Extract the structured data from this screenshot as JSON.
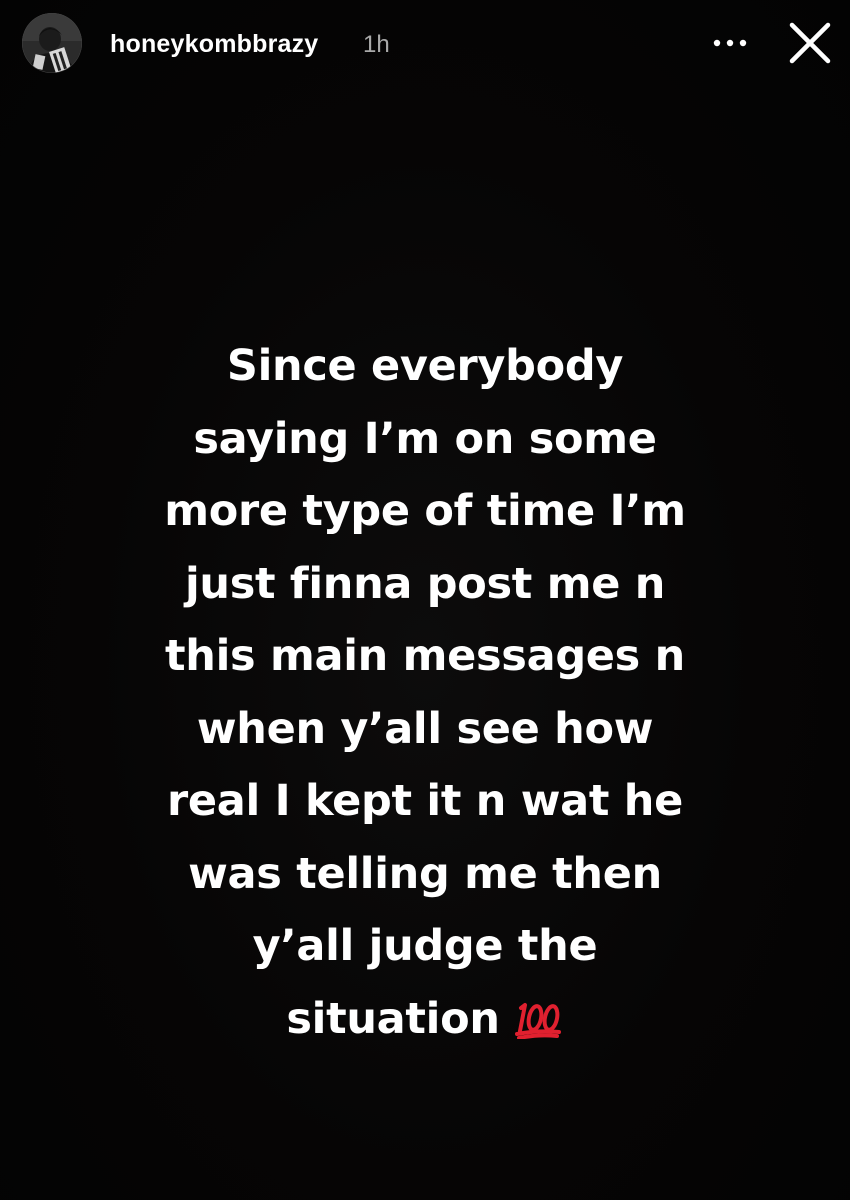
{
  "header": {
    "username": "honeykombbrazy",
    "timestamp": "1h",
    "avatar_icon": "profile-avatar",
    "more_icon": "more-options-icon",
    "close_icon": "close-icon"
  },
  "story": {
    "background_color": "#050505",
    "text_color": "#ffffff",
    "caption_lines": [
      "Since everybody",
      "saying I’m on some",
      "more type of time I’m",
      "just finna post me n",
      "this main messages n",
      "when y’all see how",
      "real I kept it n wat he",
      "was telling me then",
      "y’all judge the",
      "situation"
    ],
    "caption_emoji": "hundred-points-emoji",
    "emoji_color": "#e0202f"
  }
}
